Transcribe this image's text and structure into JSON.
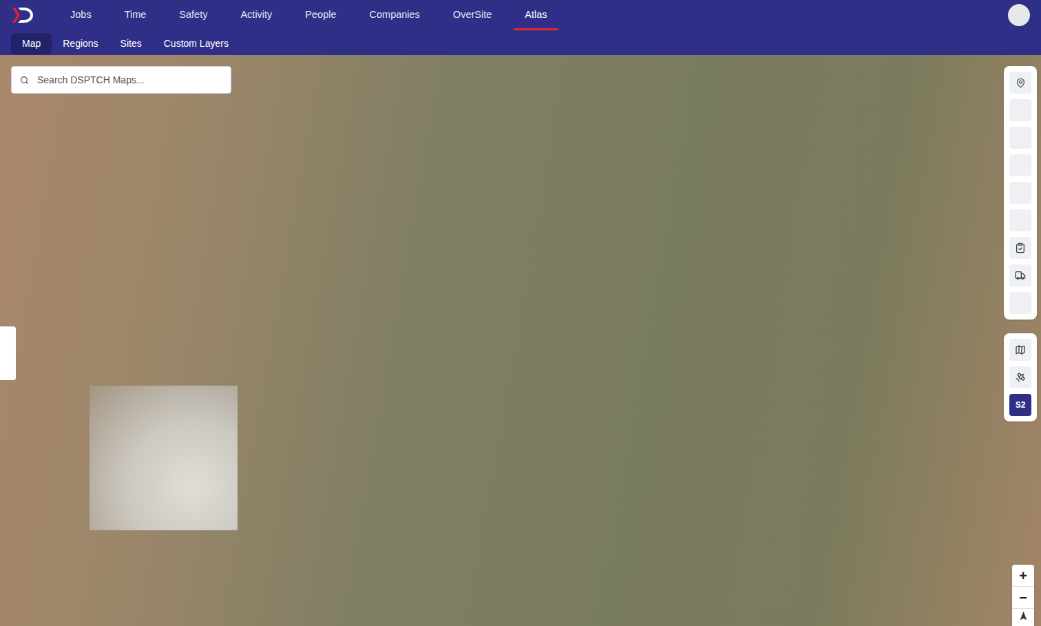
{
  "nav": {
    "items": [
      {
        "label": "Jobs",
        "selected": false
      },
      {
        "label": "Time",
        "selected": false
      },
      {
        "label": "Safety",
        "selected": false
      },
      {
        "label": "Activity",
        "selected": false
      },
      {
        "label": "People",
        "selected": false
      },
      {
        "label": "Companies",
        "selected": false
      },
      {
        "label": "OverSite",
        "selected": false
      },
      {
        "label": "Atlas",
        "selected": true
      }
    ]
  },
  "subnav": {
    "items": [
      {
        "label": "Map",
        "selected": true
      },
      {
        "label": "Regions",
        "selected": false
      },
      {
        "label": "Sites",
        "selected": false
      },
      {
        "label": "Custom Layers",
        "selected": false
      }
    ]
  },
  "search": {
    "placeholder": "Search DSPTCH Maps..."
  },
  "toolbar": {
    "tools": [
      {
        "kind": "pin"
      },
      {
        "kind": "blank"
      },
      {
        "kind": "blank"
      },
      {
        "kind": "blank"
      },
      {
        "kind": "blank"
      },
      {
        "kind": "blank"
      },
      {
        "kind": "tasks"
      },
      {
        "kind": "truck"
      },
      {
        "kind": "blank"
      }
    ]
  },
  "layers": [
    {
      "kind": "map",
      "label": "",
      "selected": false
    },
    {
      "kind": "satellite",
      "label": "",
      "selected": false
    },
    {
      "kind": "text",
      "label": "S2",
      "selected": true
    }
  ],
  "zoom": {
    "in": "+",
    "out": "−"
  }
}
